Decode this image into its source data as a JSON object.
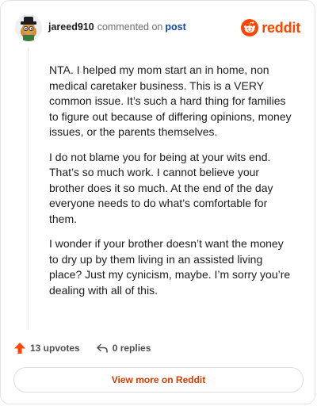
{
  "header": {
    "username": "jareed910",
    "action_text": "commented on",
    "post_link": "post",
    "brand": "reddit"
  },
  "comment": {
    "paragraphs": [
      "NTA. I helped my mom start an in home, non medical caretaker business. This is a VERY common issue. It’s such a hard thing for families to figure out because of differing opinions, money issues, or the parents themselves.",
      "I do not blame you for being at your wits end. That’s so much work. I cannot believe your brother does it so much. At the end of the day everyone needs to do what’s comfortable for them.",
      "I wonder if your brother doesn’t want the money to dry up by them living in an assisted living place? Just my cynicism, maybe. I’m sorry you’re dealing with all of this."
    ]
  },
  "actions": {
    "upvotes": "13 upvotes",
    "replies": "0 replies"
  },
  "footer": {
    "view_more": "View more on Reddit"
  },
  "colors": {
    "brand": "#ff4500",
    "link": "#0f4aa0",
    "button_text": "#d93a00"
  }
}
